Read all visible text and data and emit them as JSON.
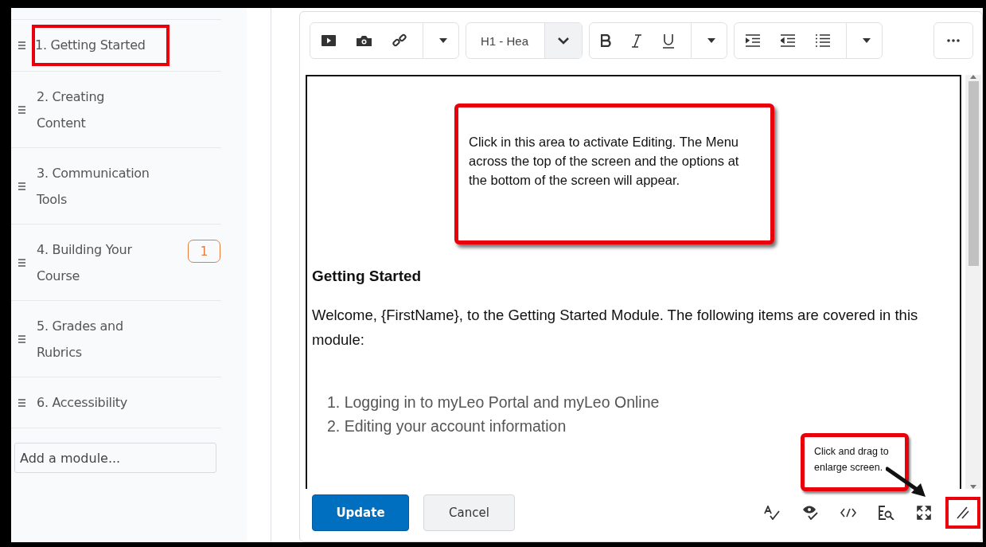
{
  "modules": [
    {
      "label": "1. Getting Started",
      "highlighted": true
    },
    {
      "label": "2. Creating Content",
      "highlighted": false
    },
    {
      "label": "3. Communication Tools",
      "highlighted": false
    },
    {
      "label": "4. Building Your Course",
      "badge": "1",
      "highlighted": false
    },
    {
      "label": "5. Grades and Rubrics",
      "highlighted": false
    },
    {
      "label": "6. Accessibility",
      "highlighted": false
    }
  ],
  "add_module": {
    "placeholder": "Add a module..."
  },
  "toolbar": {
    "heading_select": "H1 - Hea"
  },
  "content": {
    "heading": "Getting Started",
    "paragraph": "Welcome, {FirstName}, to the Getting Started Module. The following items are covered in this module:",
    "list": [
      {
        "number": "1.",
        "text": "Logging in to myLeo Portal and myLeo Online"
      },
      {
        "number": "2.",
        "text": "Editing your account information"
      }
    ]
  },
  "callouts": [
    {
      "text": "Click in this area to activate Editing. The Menu across the top of the screen and the options at the bottom of the screen will appear."
    },
    {
      "text": "Click and drag to enlarge screen."
    }
  ],
  "buttons": {
    "primary": "Update",
    "secondary": "Cancel"
  },
  "resize_handle": {
    "highlighted": true
  }
}
